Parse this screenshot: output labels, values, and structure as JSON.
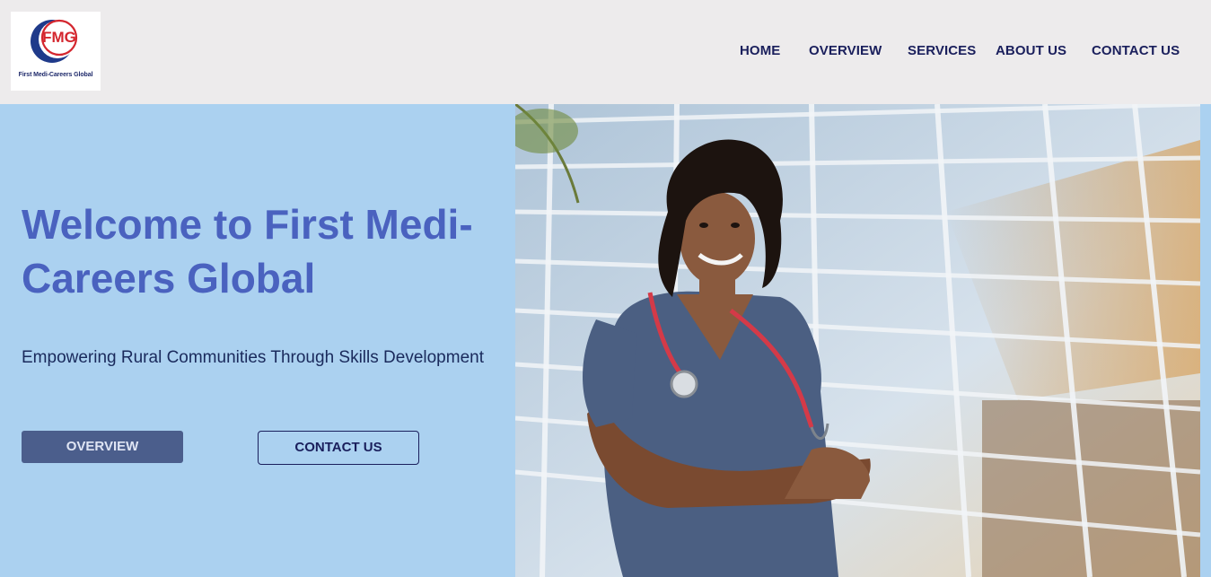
{
  "header": {
    "logo": {
      "mark": "FMG",
      "caption": "First Medi-Careers Global"
    },
    "nav": [
      {
        "label": "HOME"
      },
      {
        "label": "OVERVIEW"
      },
      {
        "label": "SERVICES"
      },
      {
        "label": "ABOUT US"
      },
      {
        "label": "CONTACT US"
      }
    ]
  },
  "hero": {
    "title": "Welcome to First Medi-Careers Global",
    "subtitle": "Empowering Rural Communities Through Skills Development",
    "buttons": {
      "overview_label": "OVERVIEW",
      "contact_label": "CONTACT US"
    },
    "image_subject": "nurse-in-scrubs-with-stethoscope-photo"
  },
  "colors": {
    "header_bg": "#edebec",
    "hero_bg": "#abd1f0",
    "title": "#4a62bf",
    "nav_text": "#1a1f5c",
    "primary_button": "#4b5e8c",
    "logo_red": "#d4262e",
    "logo_blue": "#1f3a8a"
  }
}
